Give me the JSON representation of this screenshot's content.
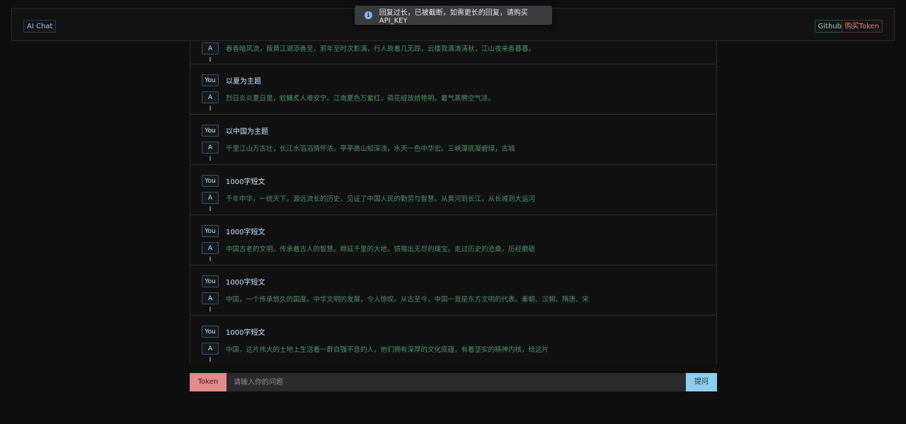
{
  "header": {
    "brand": "AI Chat",
    "github_label": "Github",
    "buy_label": "购买Token"
  },
  "toast": {
    "icon": "info-icon",
    "message": "回复过长，已被截断，如需更长的回复，请购买API_KEY"
  },
  "chat": {
    "user_tag": "You",
    "ai_tag": "A I",
    "partial_answer": "春香暗风流，叛黄江湖添香至，邪年至时次影满，行人故着几无踪，云楼我满涛清秋，江山夜来香暮暮。",
    "messages": [
      {
        "q": "以夏为主题",
        "a": "烈日炎炎夏日里，蚊蝇炙人难安宁。江南夏色万紫红，荷花绽放娇艳明。暑气蒸腾空气凉。"
      },
      {
        "q": "以中国为主题",
        "a": "千里江山万古壮，长江水滔滔情怀浓。亭亭高山知深浅，水天一色中华宏。三峡潭底凝碧绿，古城"
      },
      {
        "q": "1000字短文",
        "a": "千年中华，一统天下。源远流长的历史，见证了中国人民的勤劳与智慧。从黄河到长江，从长城到大运河"
      },
      {
        "q": "1000字短文",
        "a": "中国古老的文明，传承着古人的智慧。绵延千里的大地，馈赠出无尽的瑰宝。走过历史的沧桑，历经磨砺"
      },
      {
        "q": "1000字短文",
        "a": "中国，一个传承悠久的国度。中华文明的发展，令人惊叹。从古至今，中国一直是东方文明的代表。秦朝、汉朝、隋唐、宋"
      },
      {
        "q": "1000字短文",
        "a": "中国，这片伟大的土地上生活着一群自强不息的人，他们拥有深厚的文化底蕴，有着坚实的精神内核，给这片"
      }
    ]
  },
  "input": {
    "token_label": "Token",
    "placeholder": "请输入你的问题",
    "value": "",
    "submit_label": "提问"
  }
}
